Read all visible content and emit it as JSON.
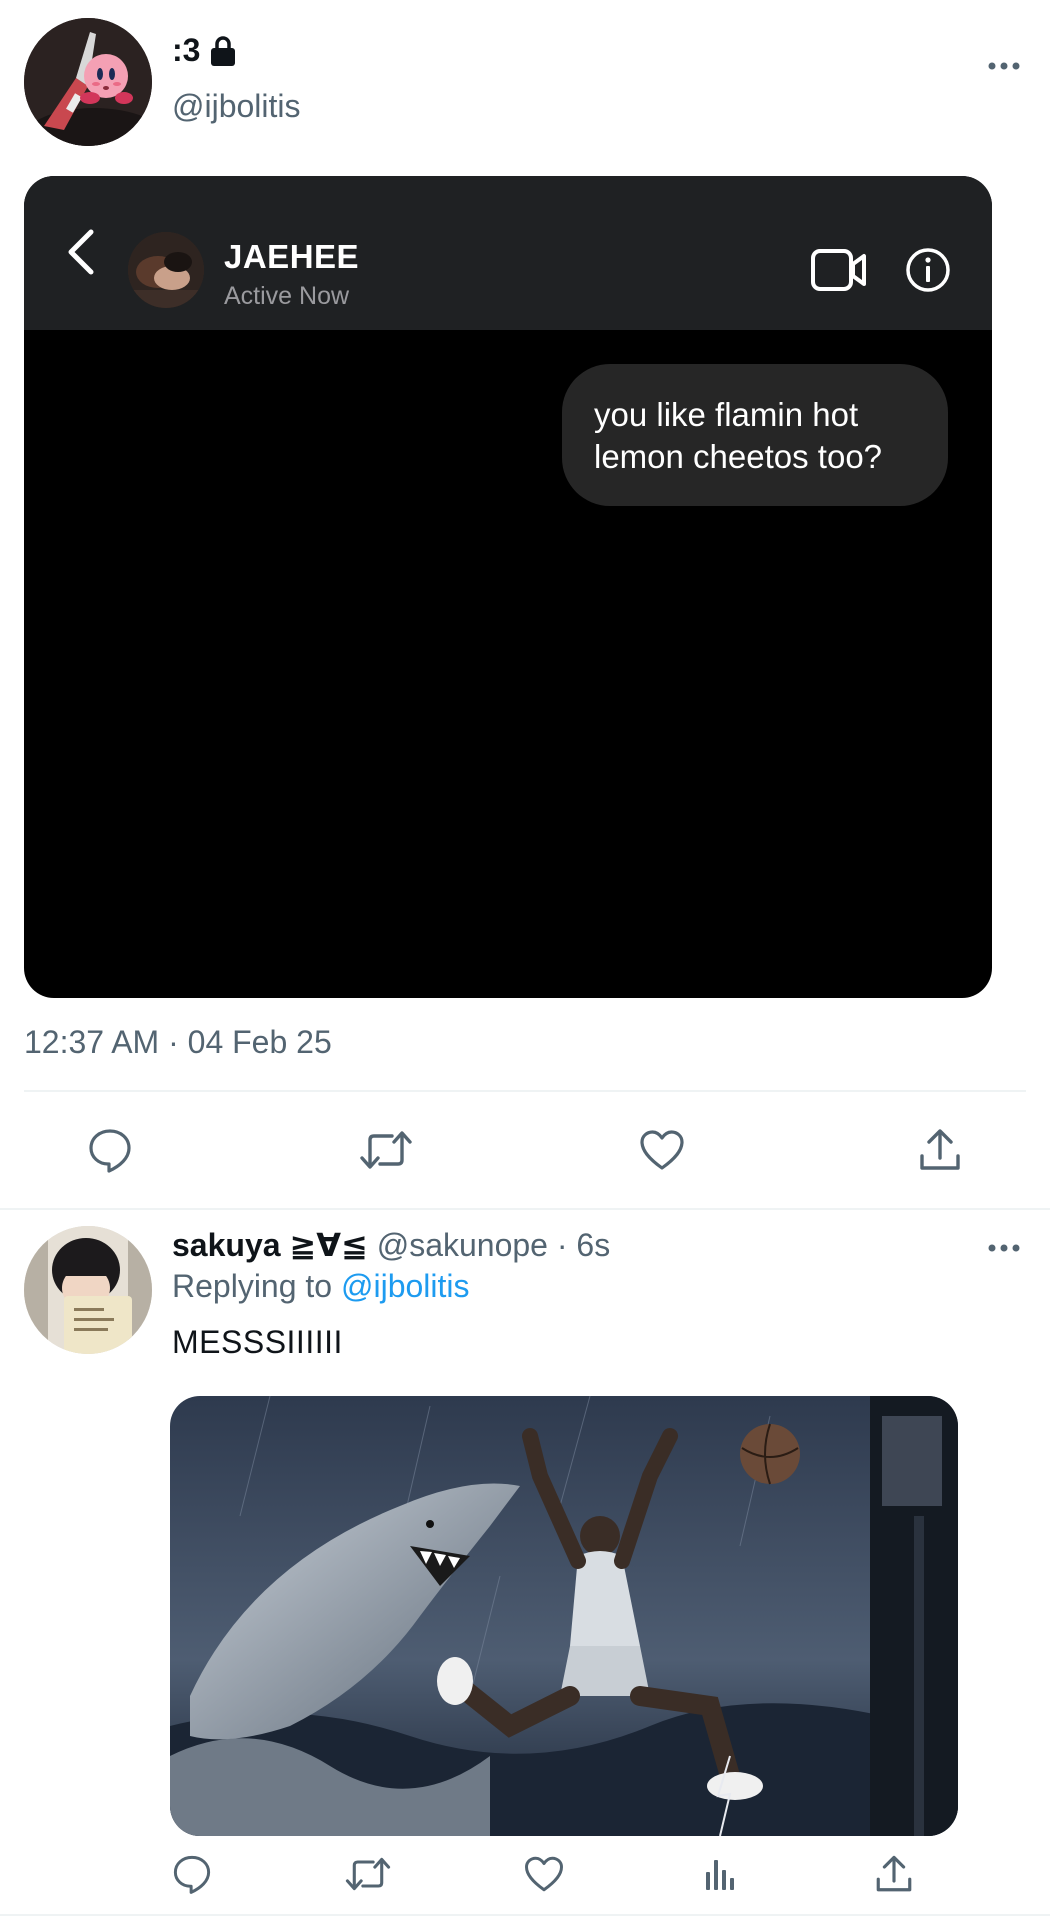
{
  "tweet": {
    "display_name": ":3",
    "handle": "@ijbolitis",
    "timestamp": "12:37 AM · 04 Feb 25",
    "media": {
      "contact_name": "JAEHEE",
      "contact_status": "Active Now",
      "message_line1": "you like flamin hot",
      "message_line2": "lemon cheetos too?"
    },
    "icons": {
      "lock": "lock-icon",
      "more": "more-horizontal-icon",
      "back": "chevron-left-icon",
      "video": "video-camera-icon",
      "info": "info-icon",
      "reply": "comment-icon",
      "retweet": "retweet-icon",
      "like": "heart-icon",
      "share": "share-icon"
    }
  },
  "reply": {
    "display_name": "sakuya ≧∀≦",
    "handle": "@sakunope",
    "separator": "·",
    "time": "6s",
    "replying_prefix": "Replying to",
    "replying_handle": "@ijbolitis",
    "text": "MESSSIIIIII",
    "icons": {
      "reply": "comment-icon",
      "retweet": "retweet-icon",
      "like": "heart-icon",
      "views": "analytics-icon",
      "share": "share-icon"
    }
  },
  "colors": {
    "text_primary": "#0f1419",
    "text_secondary": "#536471",
    "link": "#1d9bf0",
    "dm_header_bg": "#1f2123",
    "dm_bubble_bg": "#262626"
  }
}
